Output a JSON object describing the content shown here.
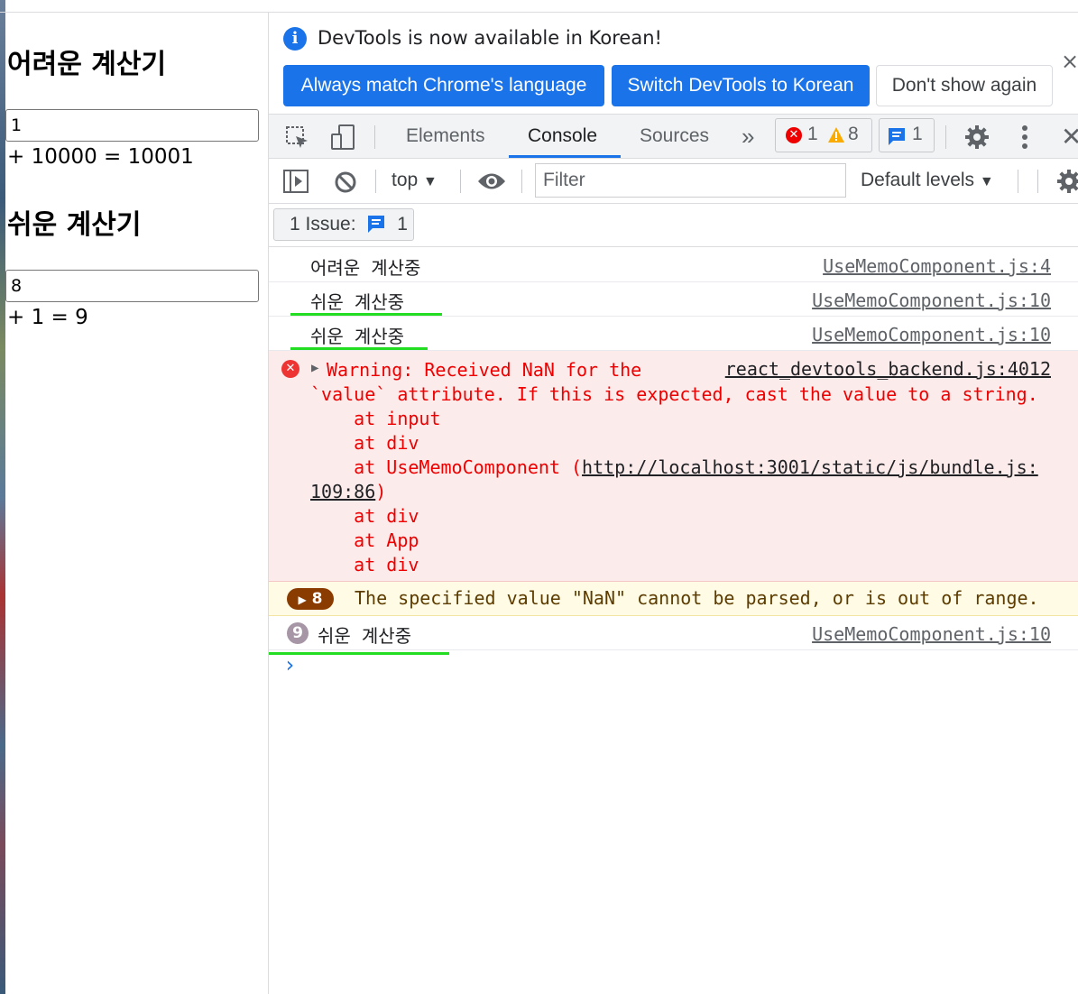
{
  "page": {
    "hard_title": "어려운 계산기",
    "hard_input": "1",
    "hard_result": "+ 10000 = 10001",
    "easy_title": "쉬운 계산기",
    "easy_input": "8",
    "easy_result": "+ 1 = 9"
  },
  "infobar": {
    "text": "DevTools is now available in Korean!",
    "btn_match": "Always match Chrome's language",
    "btn_switch": "Switch DevTools to Korean",
    "btn_dismiss": "Don't show again",
    "close": "×"
  },
  "tabs": {
    "elements": "Elements",
    "console": "Console",
    "sources": "Sources",
    "more": "»",
    "error_count": "1",
    "warning_count": "8",
    "message_count": "1"
  },
  "toolbar": {
    "context": "top",
    "filter_placeholder": "Filter",
    "levels": "Default levels"
  },
  "issues": {
    "label": "1 Issue:",
    "count": "1"
  },
  "console": {
    "rows": [
      {
        "message": "어려운 계산중",
        "source": "UseMemoComponent.js:4"
      },
      {
        "message": "쉬운 계산중",
        "source": "UseMemoComponent.js:10"
      },
      {
        "message": "쉬운 계산중",
        "source": "UseMemoComponent.js:10"
      }
    ],
    "error": {
      "line1": "Warning: Received NaN for the",
      "source": "react_devtools_backend.js:4012",
      "line2": "`value` attribute. If this is expected, cast the value to a string.",
      "line3": "    at input",
      "line4": "    at div",
      "line5_prefix": "    at UseMemoComponent (",
      "line5_link": "http://localhost:3001/static/js/bundle.js:",
      "line6_link": "109:86",
      "line6_suffix": ")",
      "line7": "    at div",
      "line8": "    at App",
      "line9": "    at div"
    },
    "warning": {
      "count": "8",
      "message": "The specified value \"NaN\" cannot be parsed, or is out of range."
    },
    "last": {
      "count": "9",
      "message": "쉬운 계산중",
      "source": "UseMemoComponent.js:10"
    },
    "prompt": "›"
  },
  "colors": {
    "accent": "#1a73e8",
    "error": "#e00000",
    "underline": "#22dd22"
  }
}
